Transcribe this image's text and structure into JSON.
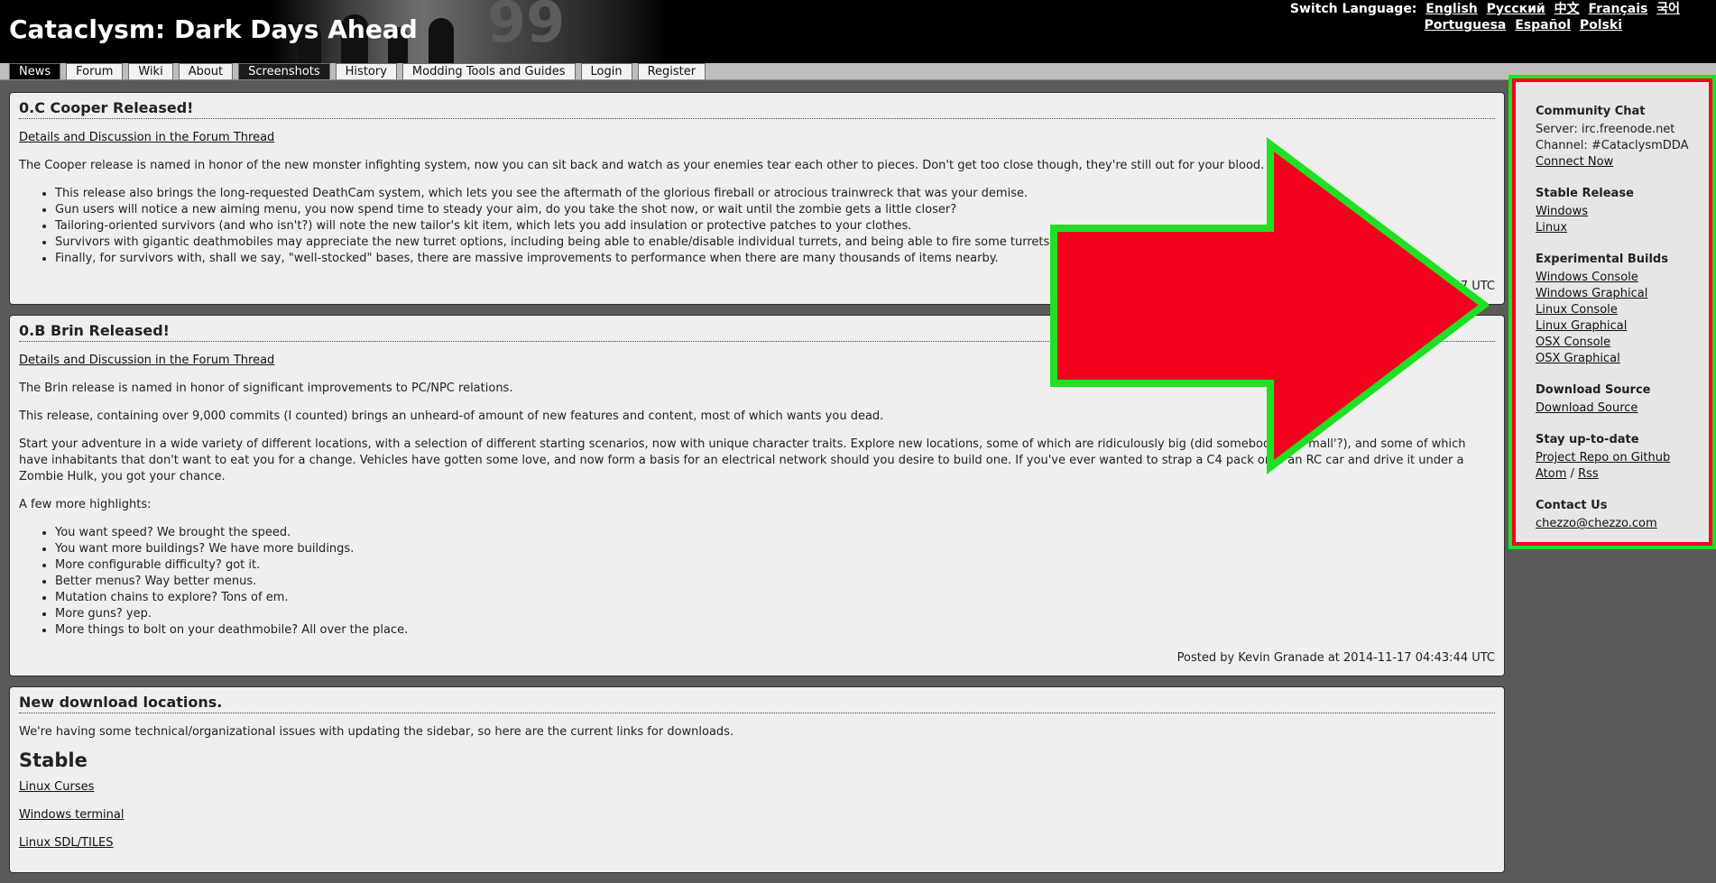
{
  "header": {
    "title": "Cataclysm: Dark Days Ahead",
    "art_number": "99"
  },
  "language": {
    "label": "Switch Language:",
    "options": [
      "English",
      "Русский",
      "中文",
      "Français",
      "국어",
      "Portuguesa",
      "Español",
      "Polski"
    ]
  },
  "nav": {
    "tabs": [
      "News",
      "Forum",
      "Wiki",
      "About",
      "Screenshots",
      "History",
      "Modding Tools and Guides",
      "Login",
      "Register"
    ],
    "active": "News"
  },
  "posts": [
    {
      "title": "0.C Cooper Released!",
      "link": "Details and Discussion in the Forum Thread",
      "intro": "The Cooper release is named in honor of the new monster infighting system, now you can sit back and watch as your enemies tear each other to pieces. Don't get too close though, they're still out for your blood.",
      "bullets": [
        "This release also brings the long-requested DeathCam system, which lets you see the aftermath of the glorious fireball or atrocious trainwreck that was your demise.",
        "Gun users will notice a new aiming menu, you now spend time to steady your aim, do you take the shot now, or wait until the zombie gets a little closer?",
        "Tailoring-oriented survivors (and who isn't?) will note the new tailor's kit item, which lets you add insulation or protective patches to your clothes.",
        "Survivors with gigantic deathmobiles may appreciate the new turret options, including being able to enable/disable individual turrets, and being able to fire some turrets",
        "Finally, for survivors with, shall we say, \"well-stocked\" bases, there are massive improvements to performance when there are many thousands of items nearby."
      ],
      "posted": "7 UTC"
    },
    {
      "title": "0.B Brin Released!",
      "link": "Details and Discussion in the Forum Thread",
      "paragraphs": [
        "The Brin release is named in honor of significant improvements to PC/NPC relations.",
        "This release, containing over 9,000 commits (I counted) brings an unheard-of amount of new features and content, most of which wants you dead.",
        "Start your adventure in a wide variety of different locations, with a selection of different starting scenarios, now with unique character traits. Explore new locations, some of which are ridiculously big (did somebody say 'mall'?), and some of which have inhabitants that don't want to eat you for a change. Vehicles have gotten some love, and now form a basis for an electrical network should you desire to build one. If you've ever wanted to strap a C4 pack onto an RC car and drive it under a Zombie Hulk, you got your chance.",
        "A few more highlights:"
      ],
      "bullets": [
        "You want speed? We brought the speed.",
        "You want more buildings? We have more buildings.",
        "More configurable difficulty? got it.",
        "Better menus? Way better menus.",
        "Mutation chains to explore? Tons of em.",
        "More guns? yep.",
        "More things to bolt on your deathmobile? All over the place."
      ],
      "posted": "Posted by Kevin Granade at 2014-11-17 04:43:44 UTC"
    },
    {
      "title": "New download locations.",
      "intro": "We're having some technical/organizational issues with updating the sidebar, so here are the current links for downloads.",
      "heading": "Stable",
      "links": [
        "Linux Curses",
        "Windows terminal",
        "Linux SDL/TILES"
      ]
    }
  ],
  "sidebar": {
    "community": {
      "title": "Community Chat",
      "server": "Server: irc.freenode.net",
      "channel": "Channel: #CataclysmDDA",
      "connect": "Connect Now"
    },
    "stable": {
      "title": "Stable Release",
      "links": [
        "Windows",
        "Linux"
      ]
    },
    "experimental": {
      "title": "Experimental Builds",
      "links": [
        "Windows Console",
        "Windows Graphical",
        "Linux Console",
        "Linux Graphical",
        "OSX Console",
        "OSX Graphical"
      ]
    },
    "source": {
      "title": "Download Source",
      "link": "Download Source"
    },
    "uptodate": {
      "title": "Stay up-to-date",
      "repo": "Project Repo on Github",
      "atom": "Atom",
      "sep": "/",
      "rss": "Rss"
    },
    "contact": {
      "title": "Contact Us",
      "email": "chezzo@chezzo.com"
    }
  },
  "colors": {
    "annotation_arrow_fill": "#f5001e",
    "annotation_outline": "#1fe024",
    "header_bg": "#000000",
    "page_bg": "#5a5a5a"
  }
}
